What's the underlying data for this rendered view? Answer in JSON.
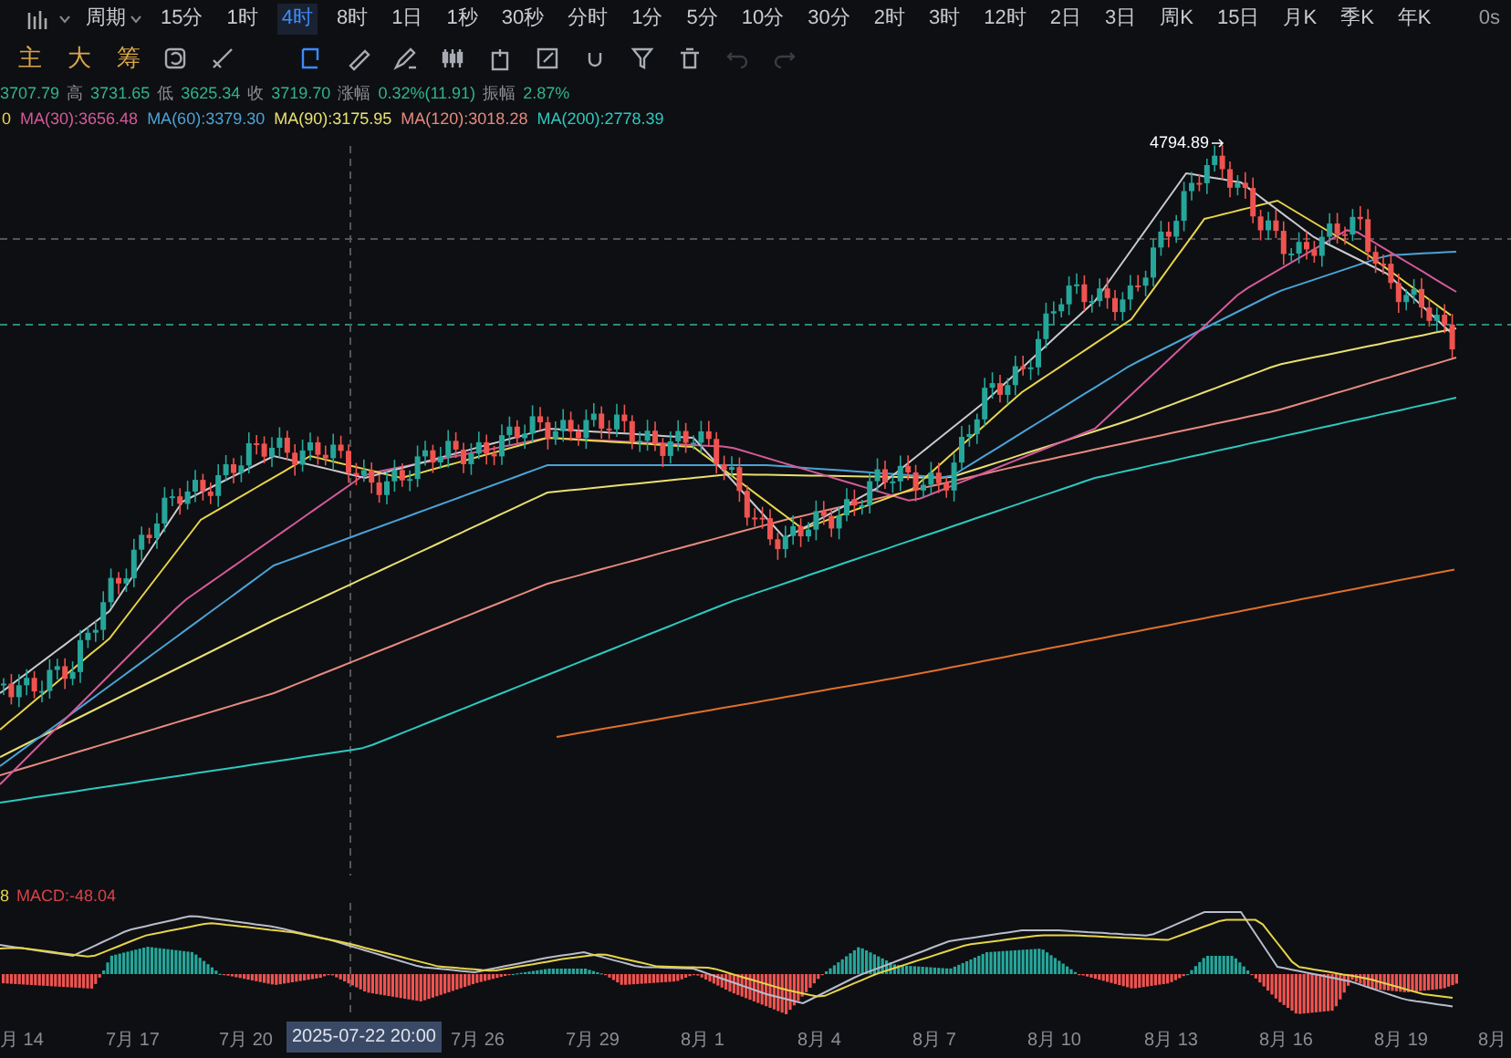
{
  "toolbar": {
    "period_label": "周期",
    "timeframes": [
      {
        "label": "15分",
        "selected": false
      },
      {
        "label": "1时",
        "selected": false
      },
      {
        "label": "4时",
        "selected": true
      },
      {
        "label": "8时",
        "selected": false
      },
      {
        "label": "1日",
        "selected": false
      },
      {
        "label": "1秒",
        "selected": false
      },
      {
        "label": "30秒",
        "selected": false
      },
      {
        "label": "分时",
        "selected": false
      },
      {
        "label": "1分",
        "selected": false
      },
      {
        "label": "5分",
        "selected": false
      },
      {
        "label": "10分",
        "selected": false
      },
      {
        "label": "30分",
        "selected": false
      },
      {
        "label": "2时",
        "selected": false
      },
      {
        "label": "3时",
        "selected": false
      },
      {
        "label": "12时",
        "selected": false
      },
      {
        "label": "2日",
        "selected": false
      },
      {
        "label": "3日",
        "selected": false
      },
      {
        "label": "周K",
        "selected": false
      },
      {
        "label": "15日",
        "selected": false
      },
      {
        "label": "月K",
        "selected": false
      },
      {
        "label": "季K",
        "selected": false
      },
      {
        "label": "年K",
        "selected": false
      }
    ],
    "timer": "0s"
  },
  "indicator_buttons": [
    "主",
    "大",
    "筹"
  ],
  "drawing_tools": [
    {
      "kind": "rotate",
      "selected": false
    },
    {
      "kind": "line",
      "selected": false
    },
    {
      "kind": "cursor",
      "selected": true
    },
    {
      "kind": "ruler",
      "selected": false
    },
    {
      "kind": "pen",
      "selected": false
    },
    {
      "kind": "candles",
      "selected": false
    },
    {
      "kind": "clip",
      "selected": false
    },
    {
      "kind": "note",
      "selected": false
    },
    {
      "kind": "magnet",
      "selected": false
    },
    {
      "kind": "filter",
      "selected": false
    },
    {
      "kind": "trash",
      "selected": false
    }
  ],
  "history_buttons": [
    {
      "kind": "undo",
      "disabled": true
    },
    {
      "kind": "redo",
      "disabled": true
    }
  ],
  "ohlc": [
    {
      "value": "3707.79"
    },
    {
      "label": "高",
      "value": "3731.65"
    },
    {
      "label": "低",
      "value": "3625.34"
    },
    {
      "label": "收",
      "value": "3719.70"
    },
    {
      "label": "涨幅",
      "value": "0.32%(11.91)"
    },
    {
      "label": "振幅",
      "value": "2.87%"
    }
  ],
  "moving_averages": [
    {
      "text": "0",
      "color": "#e6d44a"
    },
    {
      "text": "MA(30):3656.48",
      "color": "#d45a9a"
    },
    {
      "text": "MA(60):3379.30",
      "color": "#4aa3d8"
    },
    {
      "text": "MA(90):3175.95",
      "color": "#e8e070"
    },
    {
      "text": "MA(120):3018.28",
      "color": "#e88a80"
    },
    {
      "text": "MA(200):2778.39",
      "color": "#2cc9c0"
    }
  ],
  "high_marker": "4794.89",
  "macd": [
    {
      "text": "8",
      "color": "#e6d44a"
    },
    {
      "text": "MACD:-48.04",
      "color": "#d9434a"
    }
  ],
  "x_axis": {
    "labels": [
      "月 14",
      "7月 17",
      "7月 20",
      "7月 26",
      "7月 29",
      "8月 1",
      "8月 4",
      "8月 7",
      "8月 10",
      "8月 13",
      "8月 16",
      "8月 19",
      "8月"
    ],
    "crosshair_label": "2025-07-22 20:00"
  }
}
